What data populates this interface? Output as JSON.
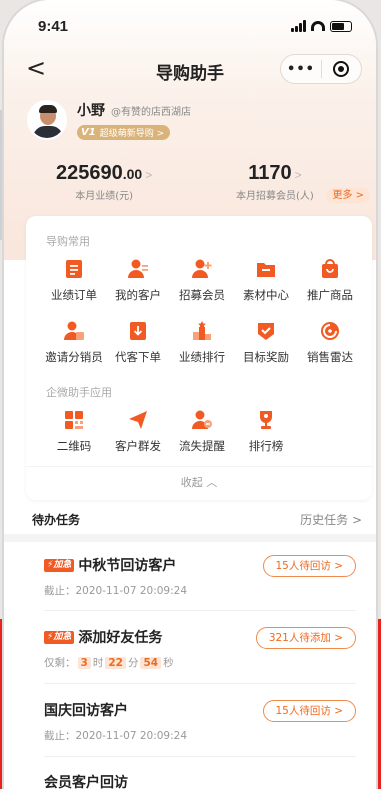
{
  "status_bar": {
    "time": "9:41"
  },
  "nav": {
    "back": "<",
    "title": "导购助手",
    "more": "•••"
  },
  "profile": {
    "name": "小野",
    "store": "@有赞的店西湖店",
    "level_badge": "V1",
    "level_text": "超级萌新导购 >"
  },
  "stats": {
    "sales_int": "225690",
    "sales_dec": ".00",
    "sales_label": "本月业绩(元)",
    "members": "1170",
    "members_label": "本月招募会员(人)",
    "arrow": ">",
    "more": "更多 >"
  },
  "sections": {
    "common_title": "导购常用",
    "wecom_title": "企微助手应用",
    "collapse": "收起 ︿"
  },
  "tools_row1": [
    {
      "label": "业绩订单",
      "icon": "order-icon"
    },
    {
      "label": "我的客户",
      "icon": "customers-icon"
    },
    {
      "label": "招募会员",
      "icon": "recruit-icon"
    },
    {
      "label": "素材中心",
      "icon": "folder-icon"
    },
    {
      "label": "推广商品",
      "icon": "bag-icon"
    }
  ],
  "tools_row2": [
    {
      "label": "邀请分销员",
      "icon": "invite-icon"
    },
    {
      "label": "代客下单",
      "icon": "place-order-icon"
    },
    {
      "label": "业绩排行",
      "icon": "ranking-icon"
    },
    {
      "label": "目标奖励",
      "icon": "reward-icon"
    },
    {
      "label": "销售雷达",
      "icon": "radar-icon"
    }
  ],
  "tools_row3": [
    {
      "label": "二维码",
      "icon": "qrcode-icon"
    },
    {
      "label": "客户群发",
      "icon": "send-icon"
    },
    {
      "label": "流失提醒",
      "icon": "churn-icon"
    },
    {
      "label": "排行榜",
      "icon": "trophy-icon"
    }
  ],
  "tasks": {
    "title": "待办任务",
    "history": "历史任务 >",
    "items": [
      {
        "tag": "⚡加急",
        "name": "中秋节回访客户",
        "sub": "截止：2020-11-07 20:09:24",
        "pill": "15人待回访 >"
      },
      {
        "tag": "⚡加急",
        "name": "添加好友任务",
        "sub_prefix": "仅剩：",
        "d": "3",
        "d_unit": "时",
        "h": "22",
        "h_unit": "分",
        "m": "54",
        "m_unit": "秒",
        "pill": "321人待添加 >"
      },
      {
        "name": "国庆回访客户",
        "sub": "截止：2020-11-07 20:09:24",
        "pill": "15人待回访 >"
      },
      {
        "name": "会员客户回访"
      }
    ]
  },
  "colors": {
    "accent": "#f15a23",
    "brand_red": "#e8231f",
    "gold": "#d9b37a"
  }
}
